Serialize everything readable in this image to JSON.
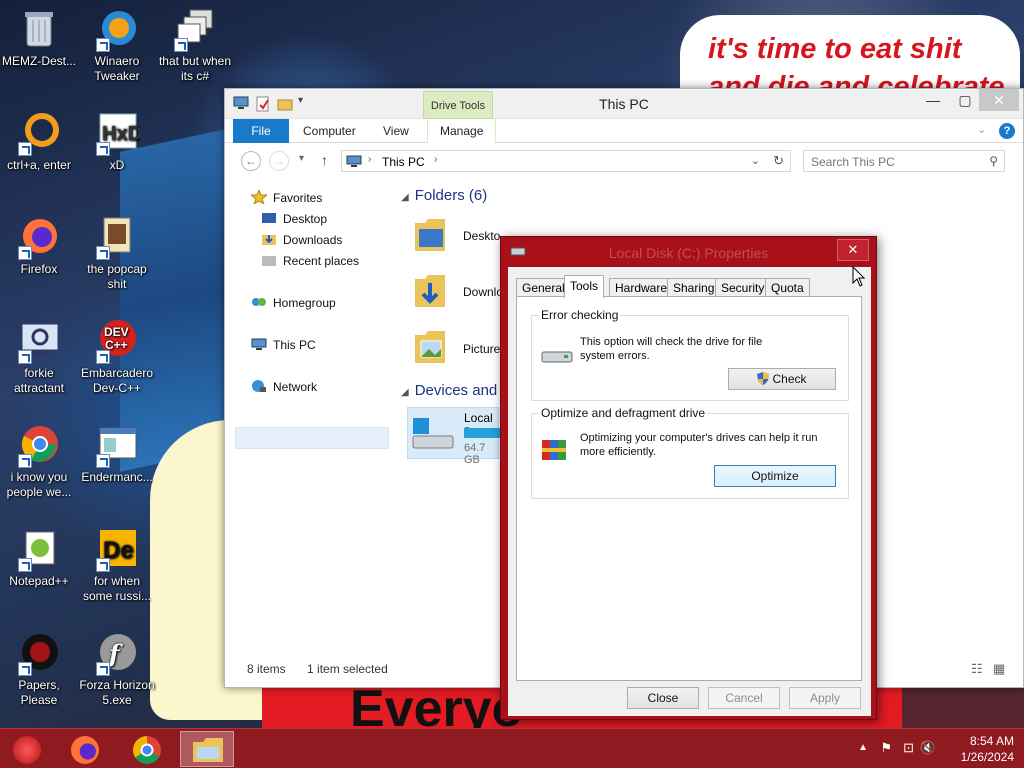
{
  "wallpaper": {
    "speech_line1": "it's time to eat shit",
    "speech_line2": "and die and celebrate",
    "banner": "Everyo"
  },
  "desktop_icons": [
    {
      "label": "MEMZ-Dest..."
    },
    {
      "label": "Winaero Tweaker"
    },
    {
      "label": "that but when its c#"
    },
    {
      "label": "ctrl+a, enter"
    },
    {
      "label": "xD"
    },
    {
      "label": "Firefox"
    },
    {
      "label": "the popcap shit"
    },
    {
      "label": "forkie attractant"
    },
    {
      "label": "Embarcadero Dev-C++"
    },
    {
      "label": "i know you people we..."
    },
    {
      "label": "Endermanc..."
    },
    {
      "label": "Notepad++"
    },
    {
      "label": "for when some russi..."
    },
    {
      "label": "Papers, Please"
    },
    {
      "label": "Forza Horizon 5.exe"
    }
  ],
  "explorer": {
    "title": "This PC",
    "drive_tools": "Drive Tools",
    "ribbon_tabs": [
      "File",
      "Computer",
      "View",
      "Manage"
    ],
    "address": "This PC",
    "search_placeholder": "Search This PC",
    "nav": {
      "favorites": "Favorites",
      "desktop": "Desktop",
      "downloads": "Downloads",
      "recent": "Recent places",
      "homegroup": "Homegroup",
      "thispc": "This PC",
      "network": "Network"
    },
    "folders_header": "Folders (6)",
    "folders": [
      "Deskto",
      "Downlo",
      "Picture"
    ],
    "devices_header": "Devices and d",
    "drive": {
      "name": "Local D",
      "free": "64.7 GB"
    },
    "status_items": "8 items",
    "status_selected": "1 item selected"
  },
  "dialog": {
    "title": "Local Disk (C:) Properties",
    "tabs": [
      "General",
      "Tools",
      "Hardware",
      "Sharing",
      "Security",
      "Quota"
    ],
    "selected_tab": "Tools",
    "error_checking": {
      "legend": "Error checking",
      "desc": "This option will check the drive for file system errors.",
      "button": "Check"
    },
    "optimize": {
      "legend": "Optimize and defragment drive",
      "desc": "Optimizing your computer's drives can help it run more efficiently.",
      "button": "Optimize"
    },
    "buttons": {
      "close": "Close",
      "cancel": "Cancel",
      "apply": "Apply"
    }
  },
  "taskbar": {
    "time": "8:54 AM",
    "date": "1/26/2024"
  },
  "colors": {
    "accent": "#1979ca",
    "dialog_frame": "#a8101a",
    "taskbar": "#8f1a1f"
  }
}
